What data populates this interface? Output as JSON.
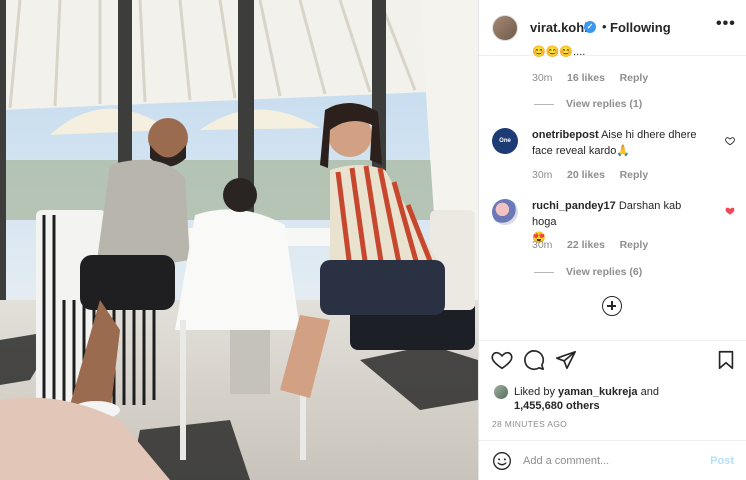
{
  "header": {
    "username": "virat.kohli",
    "verified_mark": "✓",
    "separator": "•",
    "follow_status": "Following",
    "more_label": "•••"
  },
  "comments": [
    {
      "text": "😊😊😊....",
      "age": "30m",
      "likes": "16 likes",
      "reply": "Reply",
      "view_replies": "View replies (1)"
    },
    {
      "username": "onetribepost",
      "avatar_text": "One Tribe",
      "text": "Aise hi dhere dhere face reveal kardo🙏",
      "age": "30m",
      "likes": "20 likes",
      "reply": "Reply"
    },
    {
      "username": "ruchi_pandey17",
      "text": "Darshan kab hoga",
      "emoji": "😍",
      "age": "30m",
      "likes": "22 likes",
      "reply": "Reply",
      "view_replies": "View replies (6)"
    }
  ],
  "likes": {
    "prefix": "Liked by",
    "first_user": "yaman_kukreja",
    "connector": "and",
    "others": "1,455,680 others"
  },
  "posted_time": "28 MINUTES AGO",
  "composer": {
    "placeholder": "Add a comment...",
    "post_label": "Post"
  },
  "icons": [
    "heart-icon",
    "comment-icon",
    "share-icon",
    "save-icon",
    "emoji-icon",
    "load-more-icon",
    "more-icon",
    "verified-badge-icon"
  ],
  "colors": {
    "verified": "#3897f0",
    "liked_heart": "#ed4956",
    "post_disabled": "#b2dffc"
  }
}
